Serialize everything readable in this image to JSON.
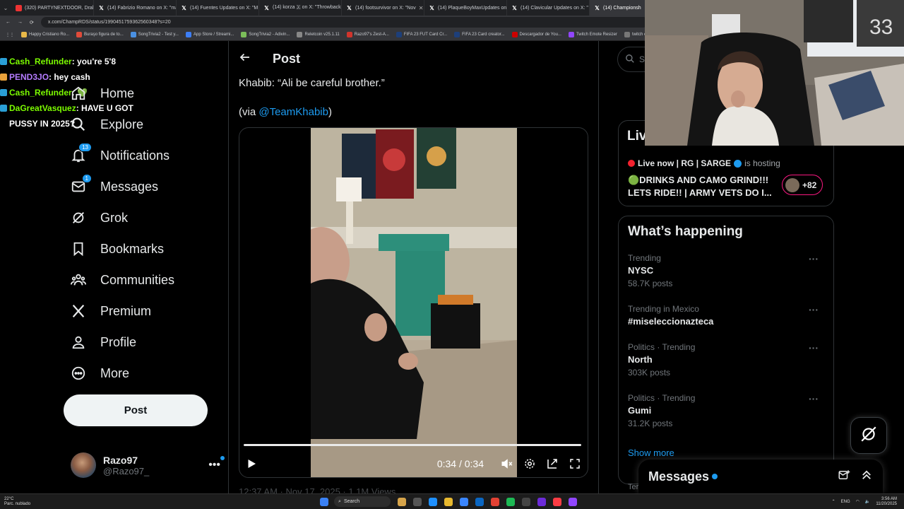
{
  "browser": {
    "tabs": [
      {
        "label": "(320) PARTYNEXTDOOR, Drake",
        "icon": "youtube-icon"
      },
      {
        "label": "(14) Fabrizio Romano on X: \"ma",
        "icon": "x-icon"
      },
      {
        "label": "(14) Fuentes Updates on X: \"M",
        "icon": "x-icon"
      },
      {
        "label": "(14) korza 🇽 on X: \"Throwback",
        "icon": "x-icon"
      },
      {
        "label": "(14) footsurvivor on X: \"Nov",
        "icon": "x-icon"
      },
      {
        "label": "(14) PlaqueBoyMaxUpdates on",
        "icon": "x-icon"
      },
      {
        "label": "(14) Clavicular Updates on X: \"",
        "icon": "x-icon"
      },
      {
        "label": "(14) Championsh",
        "icon": "x-icon"
      }
    ],
    "url": "x.com/ChampRDS/status/1990451759362560348?s=20",
    "bookmarks": [
      "Happy Cristiano Ro...",
      "Buraşo figura de to...",
      "SongTrivia2 - Test y...",
      "App Store / Streami...",
      "SongTrivia2 - Adivin...",
      "Reletcoin v25.1.11",
      "Razo97's Zest-A...",
      "FIFA 23 FUT Card Cr...",
      "FIFA 23 Card creator...",
      "Descargador de You...",
      "Twitch Emote Resizer",
      "twitch emote r"
    ]
  },
  "chat": [
    {
      "user": "Cash_Refunder",
      "msg": ": you're 5'8",
      "color": "#7cfc00"
    },
    {
      "user": "PEND3JO",
      "msg": ": hey cash",
      "color": "#b57cff"
    },
    {
      "user": "Cash_Refunder",
      "msg": ": 💚",
      "color": "#7cfc00"
    },
    {
      "user": "DaGreatVasquez",
      "msg": ": HAVE U GOT PUSSY IN 2025?",
      "color": "#7cfc00"
    }
  ],
  "nav": {
    "home": "Home",
    "explore": "Explore",
    "notifications": "Notifications",
    "notifications_badge": "13",
    "messages": "Messages",
    "messages_badge": "1",
    "grok": "Grok",
    "bookmarks": "Bookmarks",
    "communities": "Communities",
    "premium": "Premium",
    "profile": "Profile",
    "more": "More",
    "post_button": "Post"
  },
  "account": {
    "name": "Razo97",
    "handle": "@Razo97_"
  },
  "post": {
    "header_title": "Post",
    "text": "Khabib: “Ali be careful brother.”",
    "via_prefix": "(via ",
    "via_handle": "@TeamKhabib",
    "via_suffix": ")",
    "video_time": "0:34 / 0:34",
    "video_progress": 1.0,
    "meta": "12:37 AM · Nov 17, 2025 · 1.1M Views"
  },
  "right": {
    "search_placeholder": "Se",
    "live_heading": "Liv",
    "live_host_name": "Live now | RG | SARGE",
    "live_host_suffix": "is hosting",
    "live_title": "🟢DRINKS AND CAMO GRIND!!! LETS RIDE!! | ARMY VETS DO I...",
    "live_count": "+82",
    "happening_title": "What’s happening",
    "trends": [
      {
        "context": "Trending",
        "name": "NYSC",
        "count": "58.7K posts"
      },
      {
        "context": "Trending in Mexico",
        "name": "#miseleccionazteca",
        "count": ""
      },
      {
        "context": "Politics · Trending",
        "name": "North",
        "count": "303K posts"
      },
      {
        "context": "Politics · Trending",
        "name": "Gumi",
        "count": "31.2K posts"
      }
    ],
    "show_more": "Show more",
    "terms": "Terms"
  },
  "messages_drawer": {
    "title": "Messages"
  },
  "taskbar": {
    "weather_temp": "22°C",
    "weather_desc": "Parc. nublado",
    "search": "Search",
    "lang": "ENG",
    "time": "3:56 AM",
    "date": "11/20/2025"
  }
}
